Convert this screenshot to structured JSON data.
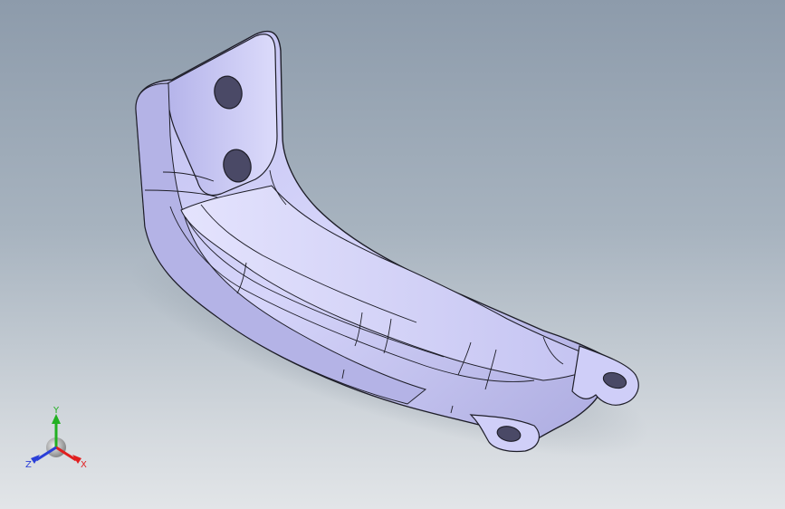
{
  "viewport": {
    "background_top": "#8d9bab",
    "background_bottom": "#e2e5e8",
    "part_color": "#c9c8f4",
    "edge_color": "#1e1e28"
  },
  "triad": {
    "x_label": "X",
    "y_label": "Y",
    "z_label": "Z",
    "x_color": "#e11f1f",
    "y_color": "#22b022",
    "z_color": "#2a3fd8"
  }
}
